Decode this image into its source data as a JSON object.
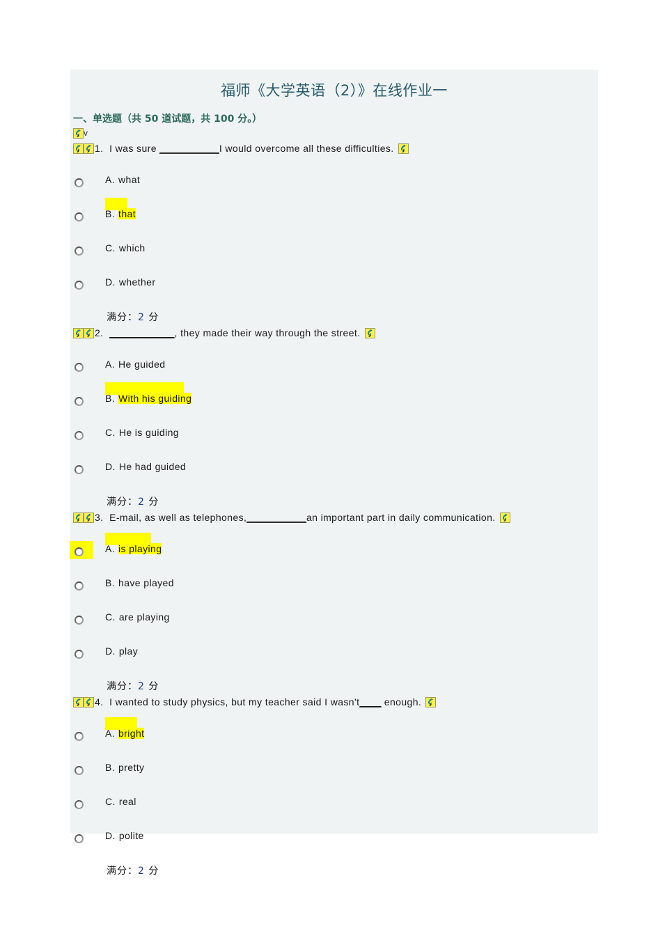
{
  "document": {
    "title": "福师《大学英语（2）》在线作业一",
    "section_header": "一、单选题（共 50 道试题，共 100 分。）",
    "stray_marker": "v",
    "score_label": "满分：",
    "score_value": "2",
    "score_unit": "分",
    "icon_name": "broken-image-placeholder-icon"
  },
  "colors": {
    "panel_background": "#eff3f3",
    "page_background": "#ffffff",
    "title_text": "#2a5d6e",
    "section_header_text": "#2f6a5c",
    "body_text": "#1a1a1a",
    "highlight": "#ffff00",
    "icon_fill": "#ffee55",
    "icon_glyph": "#00a0a0",
    "score_value_text": "#1f3f8f"
  },
  "questions": [
    {
      "number": "1.",
      "lead_icons": 2,
      "text_before": "I was sure ",
      "blank": "___________",
      "text_after": "I would overcome all these difficulties.",
      "trailing_icon": true,
      "options": [
        {
          "letter": "A.",
          "text": "what",
          "highlighted": false,
          "radio_highlighted": false
        },
        {
          "letter": "B.",
          "text": "that",
          "highlighted": true,
          "radio_highlighted": false
        },
        {
          "letter": "C.",
          "text": "which",
          "highlighted": false,
          "radio_highlighted": false
        },
        {
          "letter": "D.",
          "text": "whether",
          "highlighted": false,
          "radio_highlighted": false
        }
      ]
    },
    {
      "number": "2.",
      "lead_icons": 2,
      "text_before": "",
      "blank": "____________",
      "text_after": ", they made their way through the street.",
      "trailing_icon": true,
      "options": [
        {
          "letter": "A.",
          "text": "He guided",
          "highlighted": false,
          "radio_highlighted": false
        },
        {
          "letter": "B.",
          "text": "With his guiding",
          "highlighted": true,
          "radio_highlighted": false
        },
        {
          "letter": "C.",
          "text": "He is guiding",
          "highlighted": false,
          "radio_highlighted": false
        },
        {
          "letter": "D.",
          "text": "He had guided",
          "highlighted": false,
          "radio_highlighted": false
        }
      ]
    },
    {
      "number": "3.",
      "lead_icons": 2,
      "text_before": "E-mail, as well as telephones,",
      "blank": "___________",
      "text_after": "an important part in daily communication.",
      "trailing_icon": true,
      "options": [
        {
          "letter": "A.",
          "text": "is playing",
          "highlighted": true,
          "radio_highlighted": true
        },
        {
          "letter": "B.",
          "text": "have played",
          "highlighted": false,
          "radio_highlighted": false
        },
        {
          "letter": "C.",
          "text": "are playing",
          "highlighted": false,
          "radio_highlighted": false
        },
        {
          "letter": "D.",
          "text": "play",
          "highlighted": false,
          "radio_highlighted": false
        }
      ]
    },
    {
      "number": "4.",
      "lead_icons": 2,
      "text_before": "I wanted to study physics, but my teacher said I wasn't",
      "blank": "____",
      "text_after": " enough.",
      "trailing_icon": true,
      "options": [
        {
          "letter": "A.",
          "text": "bright",
          "highlighted": true,
          "radio_highlighted": false
        },
        {
          "letter": "B.",
          "text": "pretty",
          "highlighted": false,
          "radio_highlighted": false
        },
        {
          "letter": "C.",
          "text": "real",
          "highlighted": false,
          "radio_highlighted": false
        },
        {
          "letter": "D.",
          "text": "polite",
          "highlighted": false,
          "radio_highlighted": false
        }
      ]
    }
  ]
}
